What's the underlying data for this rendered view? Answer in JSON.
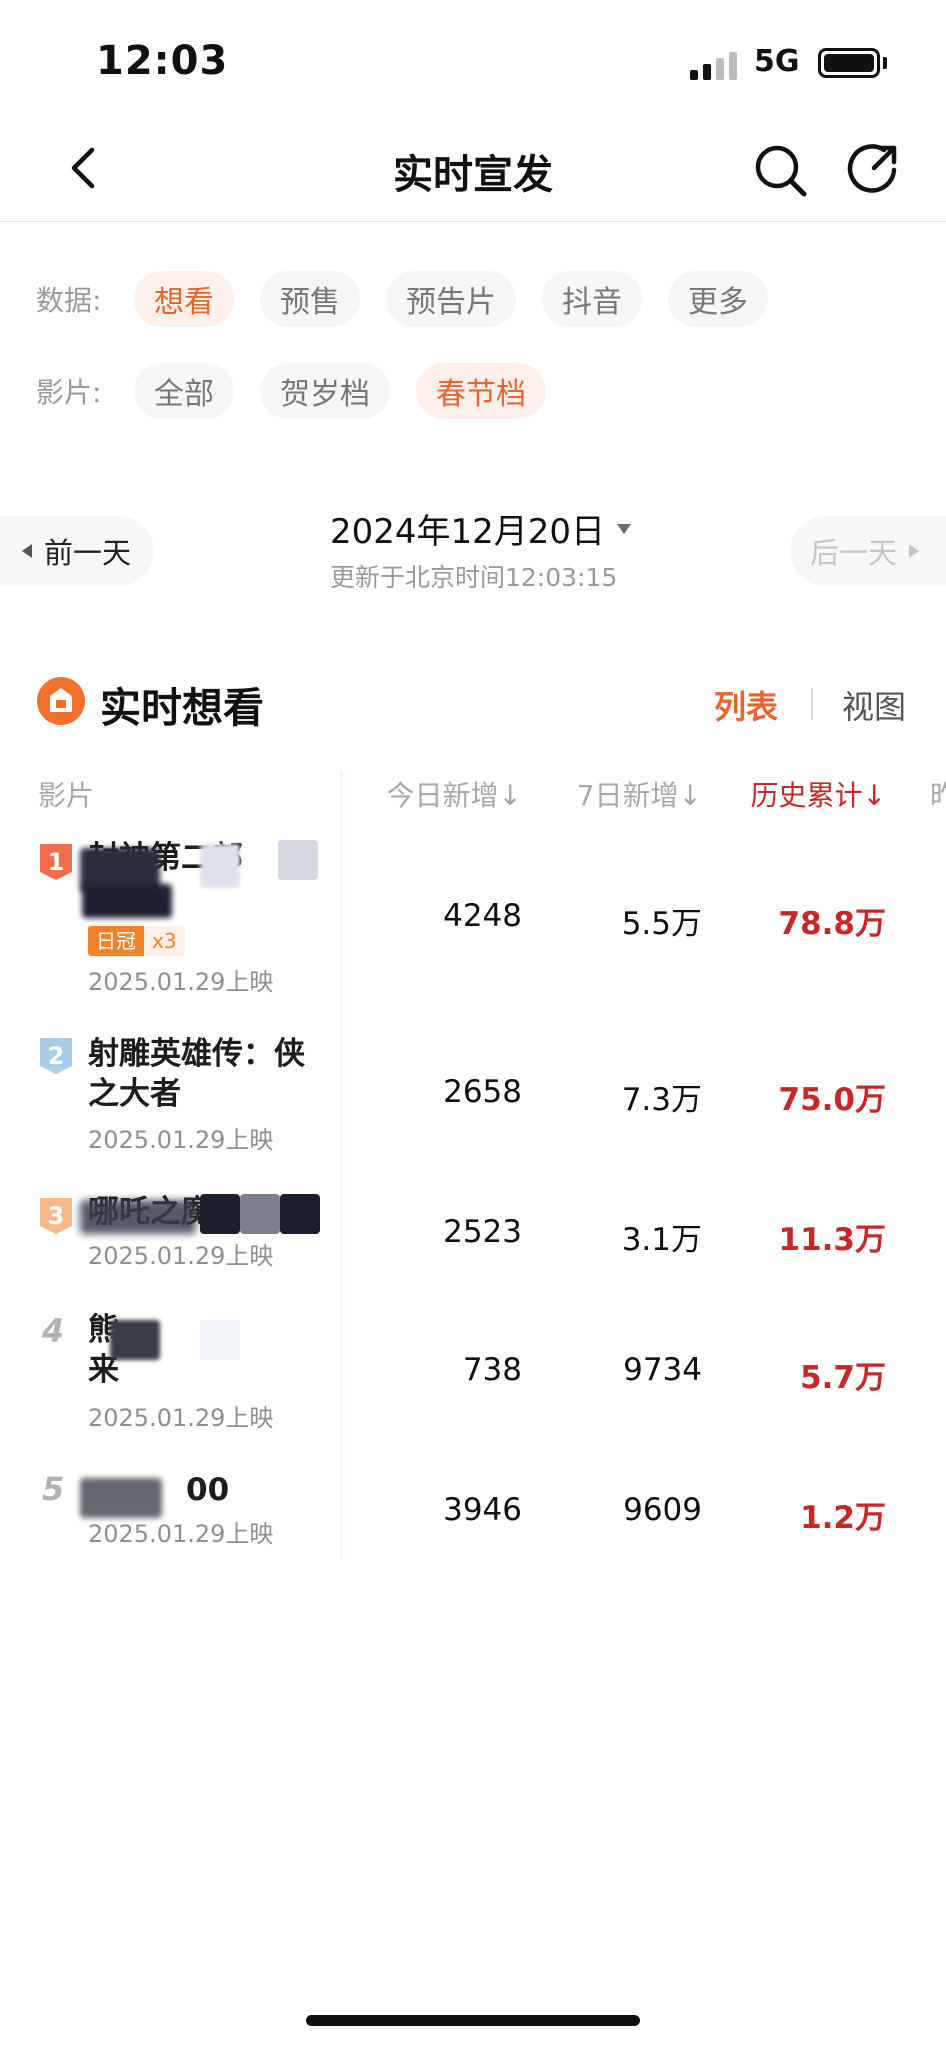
{
  "status_bar": {
    "time": "12:03",
    "network": "5G"
  },
  "nav": {
    "title": "实时宣发",
    "icons": [
      "back-chevron-icon",
      "search-icon",
      "share-icon"
    ]
  },
  "filters": {
    "data_label": "数据:",
    "data_chips": [
      {
        "label": "想看",
        "active": true
      },
      {
        "label": "预售",
        "active": false
      },
      {
        "label": "预告片",
        "active": false
      },
      {
        "label": "抖音",
        "active": false
      },
      {
        "label": "更多",
        "active": false
      }
    ],
    "film_label": "影片:",
    "film_chips": [
      {
        "label": "全部",
        "active": false
      },
      {
        "label": "贺岁档",
        "active": false
      },
      {
        "label": "春节档",
        "active": true
      }
    ]
  },
  "date_bar": {
    "prev_label": "前一天",
    "next_label": "后一天",
    "date": "2024年12月20日",
    "updated": "更新于北京时间12:03:15"
  },
  "section": {
    "title": "实时想看",
    "icon": "ticket-badge-icon",
    "view_list": "列表",
    "view_chart": "视图",
    "accent_color": "#e8642e"
  },
  "table": {
    "headers": {
      "film": "影片",
      "today": "今日新增↓",
      "week": "7日新增↓",
      "total": "历史累计↓",
      "cut": "昨"
    },
    "total_color": "#c62828",
    "rows": [
      {
        "rank": "1",
        "name_line1": "封神第二部",
        "name_line2": "",
        "badge": "日冠",
        "badge_count": "x3",
        "date": "2025.01.29上映",
        "today": "4248",
        "week": "5.5万",
        "total": "78.8万"
      },
      {
        "rank": "2",
        "name_line1": "射雕英雄传：侠",
        "name_line2": "之大者",
        "badge": "",
        "badge_count": "",
        "date": "2025.01.29上映",
        "today": "2658",
        "week": "7.3万",
        "total": "75.0万"
      },
      {
        "rank": "3",
        "name_line1": "哪吒之魔童闹",
        "name_line2": "",
        "badge": "",
        "badge_count": "",
        "date": "2025.01.29上映",
        "today": "2523",
        "week": "3.1万",
        "total": "11.3万"
      },
      {
        "rank": "4",
        "name_line1": "熊",
        "name_line2": "来",
        "badge": "",
        "badge_count": "",
        "date": "2025.01.29上映",
        "today": "738",
        "week": "9734",
        "total": "5.7万"
      },
      {
        "rank": "5",
        "name_line1": "00",
        "name_line2": "",
        "badge": "",
        "badge_count": "",
        "date": "2025.01.29上映",
        "today": "3946",
        "week": "9609",
        "total": "1.2万"
      }
    ]
  }
}
